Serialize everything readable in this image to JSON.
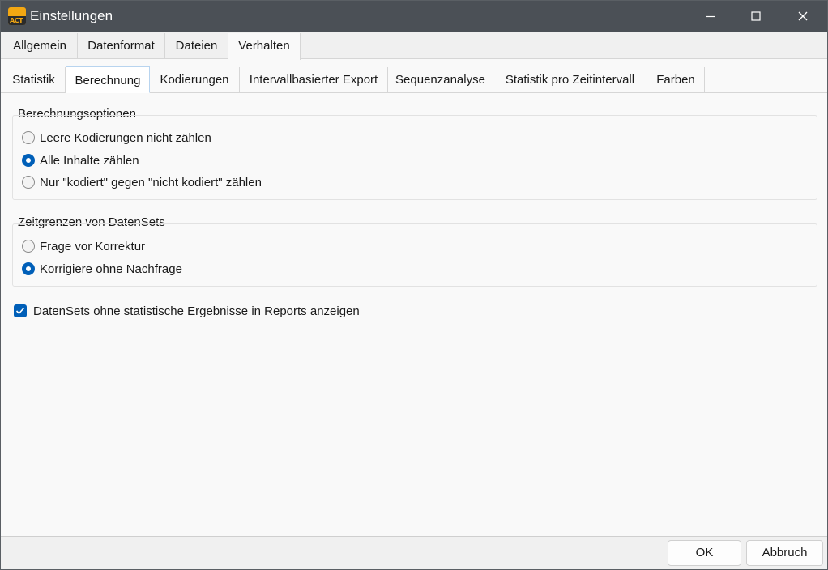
{
  "window": {
    "title": "Einstellungen",
    "app_icon_text": "ACT"
  },
  "main_tabs": [
    {
      "label": "Allgemein"
    },
    {
      "label": "Datenformat"
    },
    {
      "label": "Dateien"
    },
    {
      "label": "Verhalten",
      "active": true
    }
  ],
  "sub_tabs": [
    {
      "label": "Statistik"
    },
    {
      "label": "Berechnung",
      "active": true
    },
    {
      "label": "Kodierungen"
    },
    {
      "label": "Intervallbasierter Export"
    },
    {
      "label": "Sequenzanalyse"
    },
    {
      "label": "Statistik pro Zeitintervall"
    },
    {
      "label": "Farben"
    }
  ],
  "berechnungsoptionen": {
    "title": "Berechnungsoptionen",
    "options": [
      {
        "label": "Leere Kodierungen nicht zählen",
        "selected": false
      },
      {
        "label": "Alle Inhalte zählen",
        "selected": true
      },
      {
        "label": "Nur \"kodiert\" gegen \"nicht kodiert\" zählen",
        "selected": false
      }
    ]
  },
  "zeitgrenzen": {
    "title": "Zeitgrenzen von DatenSets",
    "options": [
      {
        "label": "Frage vor Korrektur",
        "selected": false
      },
      {
        "label": "Korrigiere ohne Nachfrage",
        "selected": true
      }
    ]
  },
  "show_datasets_checkbox": {
    "label": "DatenSets ohne statistische Ergebnisse in Reports anzeigen",
    "checked": true
  },
  "footer": {
    "ok_label": "OK",
    "cancel_label": "Abbruch"
  },
  "colors": {
    "titlebar": "#4b5056",
    "accent": "#005fb8",
    "app_icon": "#f3a712"
  }
}
